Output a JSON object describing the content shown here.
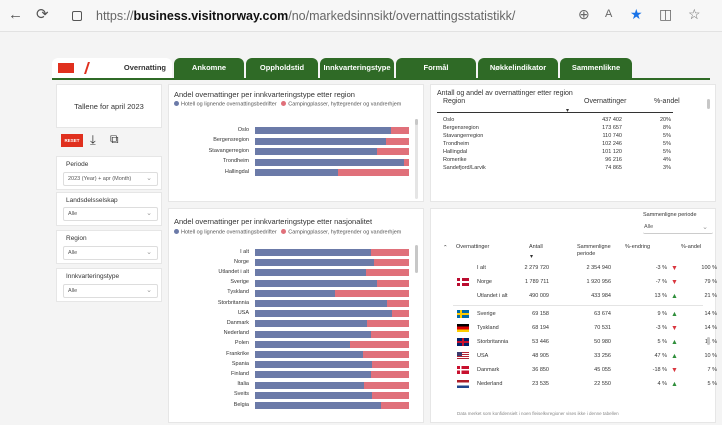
{
  "browser": {
    "url_prefix": "https://",
    "url_host": "business.visitnorway.com",
    "url_path": "/no/markedsinnsikt/overnattingsstatistikk/"
  },
  "tabs": [
    "Overnatting",
    "Ankomne",
    "Oppholdstid",
    "Innkvarteringstype",
    "Formål",
    "Nøkkelindikator",
    "Sammenlikne"
  ],
  "sidebar": {
    "title": "Tallene for april 2023",
    "reset": "RESET",
    "filters": [
      {
        "label": "Periode",
        "value": "2023 (Year) + apr (Month)"
      },
      {
        "label": "Landsdelsselskap",
        "value": "Alle"
      },
      {
        "label": "Region",
        "value": "Alle"
      },
      {
        "label": "Innkvarteringstype",
        "value": "Alle"
      }
    ]
  },
  "legend": {
    "hotel": "Hotell og lignende overnattingsbedrifter",
    "camping": "Campingplasser, hytt egrender og vandrerhjem",
    "hotel_color": "#6b7aa8",
    "camping_color": "#e0707a"
  },
  "region_chart": {
    "title": "Andel overnattinger per innkvarteringstype etter region",
    "legend_hotel": "Hotell og lignende overnattingsbedrifter",
    "legend_camping": "Campingplasser, hyttegrender og vandrerhjem"
  },
  "nat_chart": {
    "title": "Andel overnattinger per innkvarteringstype etter nasjonalitet",
    "legend_hotel": "Hotell og lignende overnattingsbedrifter",
    "legend_camping": "Campingplasser, hyttegrender og vandrerhjem"
  },
  "chart_data": [
    {
      "type": "bar",
      "title": "Andel overnattinger per innkvarteringstype etter region",
      "categories": [
        "Oslo",
        "Bergensregion",
        "Stavangerregion",
        "Trondheim",
        "Hallingdal"
      ],
      "series": [
        {
          "name": "Hotell og lignende overnattingsbedrifter",
          "values": [
            88,
            85,
            79,
            97,
            54
          ]
        },
        {
          "name": "Campingplasser, hyttegrender og vandrerhjem",
          "values": [
            12,
            15,
            21,
            3,
            46
          ]
        }
      ]
    },
    {
      "type": "bar",
      "title": "Andel overnattinger per innkvarteringstype etter nasjonalitet",
      "categories": [
        "I alt",
        "Norge",
        "Utlandet i alt",
        "Sverige",
        "Tyskland",
        "Storbritannia",
        "USA",
        "Danmark",
        "Nederland",
        "Polen",
        "Frankrike",
        "Spania",
        "Finland",
        "Italia",
        "Sveits",
        "Belgia"
      ],
      "series": [
        {
          "name": "Hotell og lignende overnattingsbedrifter",
          "values": [
            75,
            77,
            72,
            79,
            52,
            86,
            89,
            73,
            75,
            62,
            70,
            76,
            75,
            71,
            76,
            82
          ]
        },
        {
          "name": "Campingplasser, hyttegrender og vandrerhjem",
          "values": [
            25,
            23,
            28,
            21,
            48,
            14,
            11,
            27,
            25,
            38,
            30,
            24,
            25,
            29,
            24,
            18
          ]
        }
      ]
    }
  ],
  "region_table": {
    "title": "Antall og andel av overnattinger etter region",
    "headers": [
      "Region",
      "Overnattinger",
      "%-andel"
    ],
    "rows": [
      [
        "Oslo",
        "437 402",
        "20%"
      ],
      [
        "Bergensregion",
        "173 657",
        "8%"
      ],
      [
        "Stavangerregion",
        "110 740",
        "5%"
      ],
      [
        "Trondheim",
        "102 246",
        "5%"
      ],
      [
        "Hallingdal",
        "101 120",
        "5%"
      ],
      [
        "Romerike",
        "96 216",
        "4%"
      ],
      [
        "Sandefjord/Larvik",
        "74 865",
        "3%"
      ]
    ]
  },
  "compare_table": {
    "period_label": "Sammenligne periode",
    "period_value": "Alle",
    "headers": [
      "Overnattinger",
      "Antall",
      "Sammenligne periode",
      "%-endring",
      "%-andel"
    ],
    "rows": [
      {
        "name": "I alt",
        "flag": "",
        "antall": "2 279 720",
        "sammen": "2 354 940",
        "endring": "-3 %",
        "dir": "down",
        "andel": "100 %"
      },
      {
        "name": "Norge",
        "flag": "no",
        "antall": "1 789 711",
        "sammen": "1 920 956",
        "endring": "-7 %",
        "dir": "down",
        "andel": "79 %"
      },
      {
        "name": "Utlandet i alt",
        "flag": "",
        "antall": "490 009",
        "sammen": "433 984",
        "endring": "13 %",
        "dir": "up",
        "andel": "21 %"
      },
      {
        "name": "Sverige",
        "flag": "se",
        "antall": "69 158",
        "sammen": "63 674",
        "endring": "9 %",
        "dir": "up",
        "andel": "14 %"
      },
      {
        "name": "Tyskland",
        "flag": "de",
        "antall": "68 194",
        "sammen": "70 531",
        "endring": "-3 %",
        "dir": "down",
        "andel": "14 %"
      },
      {
        "name": "Storbritannia",
        "flag": "gb",
        "antall": "53 446",
        "sammen": "50 980",
        "endring": "5 %",
        "dir": "up",
        "andel": "11 %"
      },
      {
        "name": "USA",
        "flag": "us",
        "antall": "48 905",
        "sammen": "33 256",
        "endring": "47 %",
        "dir": "up",
        "andel": "10 %"
      },
      {
        "name": "Danmark",
        "flag": "dk",
        "antall": "36 850",
        "sammen": "45 055",
        "endring": "-18 %",
        "dir": "down",
        "andel": "7 %"
      },
      {
        "name": "Nederland",
        "flag": "nl",
        "antall": "23 535",
        "sammen": "22 550",
        "endring": "4 %",
        "dir": "up",
        "andel": "5 %"
      }
    ],
    "footnote": "Data merket som konfidensielt i noen fleiselkvregioner vises ikke i denne tabellen"
  }
}
